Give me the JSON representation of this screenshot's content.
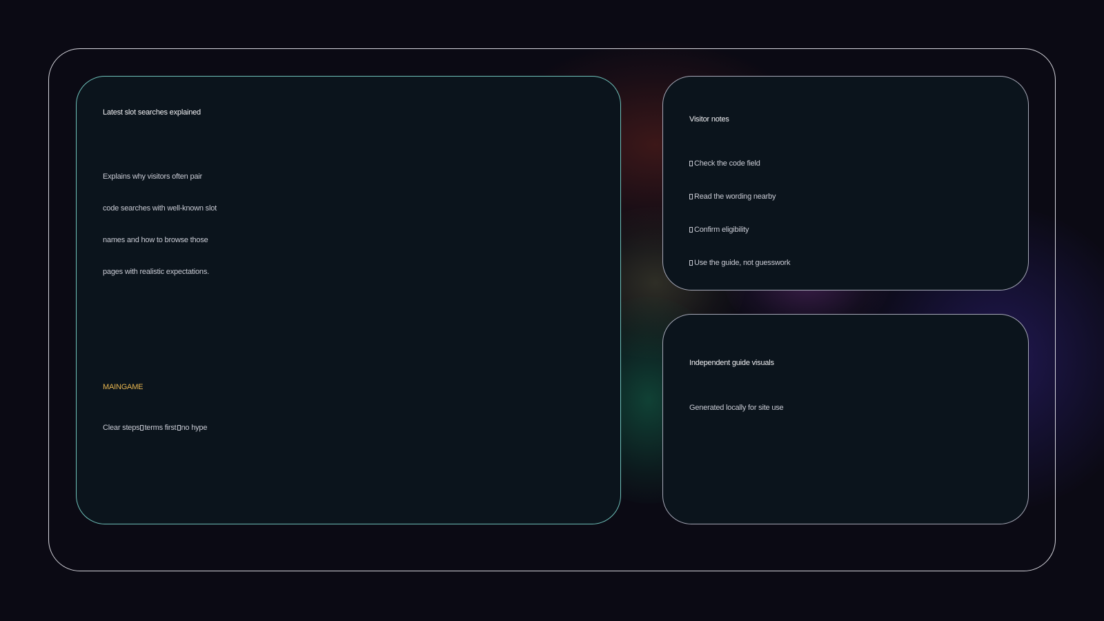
{
  "main_card": {
    "title": "Latest slot searches explained",
    "description_lines": [
      "Explains why visitors often pair",
      "code searches with well-known slot",
      "names and how to browse those",
      "pages with realistic expectations."
    ],
    "brand": "MAINGAME",
    "tagline_parts": [
      "Clear steps",
      "terms first",
      "no hype"
    ]
  },
  "notes_card": {
    "title": "Visitor notes",
    "items": [
      "Check the code field",
      "Read the wording nearby",
      "Confirm eligibility",
      "Use the guide, not guesswork"
    ]
  },
  "visuals_card": {
    "title": "Independent guide visuals",
    "subtitle": "Generated locally for site use"
  },
  "colors": {
    "background": "#0b0a14",
    "card": "#0b141c",
    "main_border": "#6fc2bb",
    "side_border": "#a7a9b8",
    "frame_border": "#d8d8df",
    "accent": "#e7b54f"
  }
}
